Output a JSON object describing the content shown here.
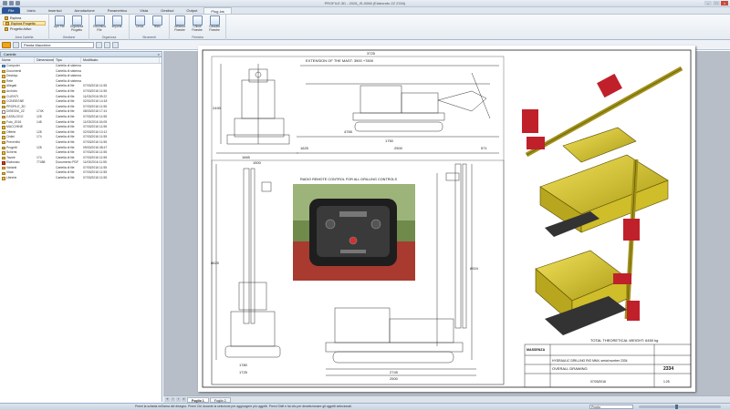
{
  "titlebar": {
    "title": "PROFILE.3D - 2026_IS-0088 (Elaborato 2Z 2334)"
  },
  "tabs": [
    "File",
    "Inizio",
    "Inserisci",
    "Annotazione",
    "Parametrico",
    "Vista",
    "Gestisci",
    "Output",
    "Plug-ins"
  ],
  "ribbon": {
    "explorer_items": [
      "Esplora",
      "Esplora Progetto",
      "Progetto Attivo"
    ],
    "explorer_label": "Area Cartella",
    "groups": [
      {
        "label": "Gestione",
        "buttons": [
          "Apri File",
          "Organizza Progetto"
        ]
      },
      {
        "label": "Organizza",
        "buttons": [
          "Rinomina File",
          "Importa"
        ]
      },
      {
        "label": "Strumenti",
        "buttons": [
          "Cerca",
          "Testo"
        ]
      },
      {
        "label": "Finestra",
        "buttons": [
          "Affianca Finestre",
          "Chiudi Finestre",
          "Cascata Finestre"
        ]
      }
    ]
  },
  "addressbar": {
    "path": "Pianta Macchine"
  },
  "panel": {
    "title": "Cartelle"
  },
  "filelist": {
    "columns": [
      "Nome",
      "Dimensione",
      "Tipo",
      "Modificato"
    ],
    "rows": [
      {
        "icon": "pc-icon",
        "name": "Computer",
        "size": "",
        "type": "Cartella di sistema",
        "date": ""
      },
      {
        "icon": "folder-icon",
        "name": "Documenti",
        "size": "",
        "type": "Cartella di sistema",
        "date": ""
      },
      {
        "icon": "folder-icon",
        "name": "Desktop",
        "size": "",
        "type": "Cartella di sistema",
        "date": ""
      },
      {
        "icon": "folder-icon",
        "name": "Rete",
        "size": "",
        "type": "Cartella di sistema",
        "date": ""
      },
      {
        "icon": "folder-icon",
        "name": "Allegati",
        "size": "",
        "type": "Cartella di file",
        "date": "07/03/2016 11:55"
      },
      {
        "icon": "folder-icon",
        "name": "Archivio",
        "size": "",
        "type": "Cartella di file",
        "date": "07/03/2016 11:55"
      },
      {
        "icon": "folder-icon",
        "name": "CLIENTI",
        "size": "",
        "type": "Cartella di file",
        "date": "11/03/2016 09:22"
      },
      {
        "icon": "folder-icon",
        "name": "CONSEGNE",
        "size": "",
        "type": "Cartella di file",
        "date": "02/02/2016 14:18"
      },
      {
        "icon": "folder-icon",
        "name": "PROFILE_3D",
        "size": "",
        "type": "Cartella di file",
        "date": "07/03/2016 11:55"
      },
      {
        "icon": "doc-icon",
        "name": "DISEGNI_2Z",
        "size": "174K",
        "type": "Cartella di file",
        "date": "08/03/2016 17:41"
      },
      {
        "icon": "folder-icon",
        "name": "CATALOGO",
        "size": "128",
        "type": "Cartella di file",
        "date": "07/03/2016 11:55"
      },
      {
        "icon": "folder-icon",
        "name": "Foto_2016",
        "size": "148",
        "type": "Cartella di file",
        "date": "11/03/2016 16:05"
      },
      {
        "icon": "folder-icon",
        "name": "MACCHINE",
        "size": "",
        "type": "Cartella di file",
        "date": "07/03/2016 11:55"
      },
      {
        "icon": "folder-icon",
        "name": "Offerte",
        "size": "128",
        "type": "Cartella di file",
        "date": "02/03/2016 10:12"
      },
      {
        "icon": "folder-icon",
        "name": "Ordini",
        "size": "174",
        "type": "Cartella di file",
        "date": "07/03/2016 11:55"
      },
      {
        "icon": "folder-icon",
        "name": "Preventivi",
        "size": "",
        "type": "Cartella di file",
        "date": "07/03/2016 11:55"
      },
      {
        "icon": "folder-icon",
        "name": "Progetti",
        "size": "128",
        "type": "Cartella di file",
        "date": "09/03/2016 08:47"
      },
      {
        "icon": "folder-icon",
        "name": "Schemi",
        "size": "",
        "type": "Cartella di file",
        "date": "07/03/2016 11:55"
      },
      {
        "icon": "folder-icon",
        "name": "Tavole",
        "size": "174",
        "type": "Cartella di file",
        "date": "07/03/2016 11:55"
      },
      {
        "icon": "red-icon",
        "name": "Elaborato",
        "size": "77488",
        "type": "Documento PDF",
        "date": "11/03/2016 11:55"
      },
      {
        "icon": "folder-icon",
        "name": "Varianti",
        "size": "",
        "type": "Cartella di file",
        "date": "07/03/2016 11:55"
      },
      {
        "icon": "folder-icon",
        "name": "Vista",
        "size": "",
        "type": "Cartella di file",
        "date": "07/03/2016 11:55"
      },
      {
        "icon": "folder-icon",
        "name": "Librerie",
        "size": "",
        "type": "Cartella di file",
        "date": "07/03/2016 11:55"
      }
    ]
  },
  "drawing": {
    "dim_top_overall": "3725",
    "top_note": "EXTENSION OF THE MAST: 3900 +7800",
    "dims_front": [
      "1665",
      "1500"
    ],
    "dims_side": [
      "1625",
      "1750",
      "2500",
      "571"
    ],
    "height_left": "2490",
    "height_top": "4765",
    "radio_title": "RADIO REMOTE CONTROL FOR ALL DRILLING CONTROLS",
    "dims_bottom_left": [
      "1780",
      "1725"
    ],
    "dims_bottom_right": [
      "2745",
      "2500"
    ],
    "dim_mast_height": "8924",
    "dim_mast_height_left": "8625",
    "title_block": {
      "company": "MASSENZA",
      "weight": "TOTAL THEORETICAL WEIGHT: 6450 kg",
      "description": "HYDRAULIC DRILLING RIG MM4, serial number 2334",
      "drawing_title": "OVERALL DRAWING",
      "drawing_no": "2334",
      "date": "07/03/2016",
      "scale": "1:25"
    }
  },
  "sheet_tabs": [
    "Foglio 1",
    "Foglio 2"
  ],
  "status": {
    "message": "Premi la scheda nell'area del disegno. Premi Ctrl durante la selezione per aggiungere più oggetti. Premi Shift e fai clic per deselezionare gli oggetti selezionati.",
    "coords": "Pronto"
  },
  "colors": {
    "accent": "#2b5797",
    "machine_yellow": "#e8d234",
    "machine_red": "#c0202a"
  }
}
